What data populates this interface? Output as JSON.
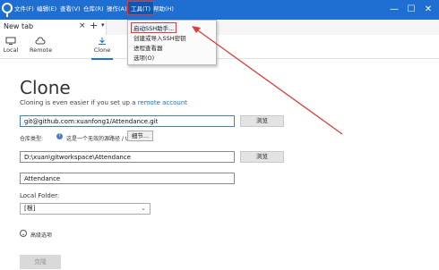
{
  "menubar": {
    "items": [
      "文件(F)",
      "编辑(E)",
      "查看(V)",
      "仓库(R)",
      "操作(A)",
      "工具(T)",
      "帮助(H)"
    ],
    "active_index": 5
  },
  "window_controls": {
    "minimize": "—",
    "maximize": "☐",
    "close": "✕"
  },
  "tabs": {
    "current": "New tab",
    "close": "×",
    "add": "+",
    "dropdown": "▾"
  },
  "toolbar": {
    "local": "Local",
    "remote": "Remote",
    "clone": "Clone"
  },
  "tools_menu": {
    "items": [
      "启动SSH助手...",
      "创建或导入SSH密钥",
      "进程查看器",
      "选项(O)"
    ],
    "highlighted_index": 0
  },
  "clone_page": {
    "title": "Clone",
    "subtitle_prefix": "Cloning is even easier if you set up a ",
    "subtitle_link": "remote account",
    "source_url": "git@github.com:xuanfong1/Attendance.git",
    "browse_label": "浏览",
    "repo_type_label": "仓库类型:",
    "repo_type_help": "?",
    "repo_type_text": "这是一个无效的源路径 / URL",
    "detail_label": "细节...",
    "destination_path": "D:\\xuan\\gitworkspace\\Attendance",
    "browse2_label": "浏览",
    "name_value": "Attendance",
    "local_folder_label": "Local Folder:",
    "local_folder_value": "[根]",
    "advanced_label": "高级选项",
    "clone_button": "克隆"
  },
  "colors": {
    "titlebar": "#1e6fd1",
    "link": "#1a6fd0",
    "annotation": "#e23a3a"
  }
}
